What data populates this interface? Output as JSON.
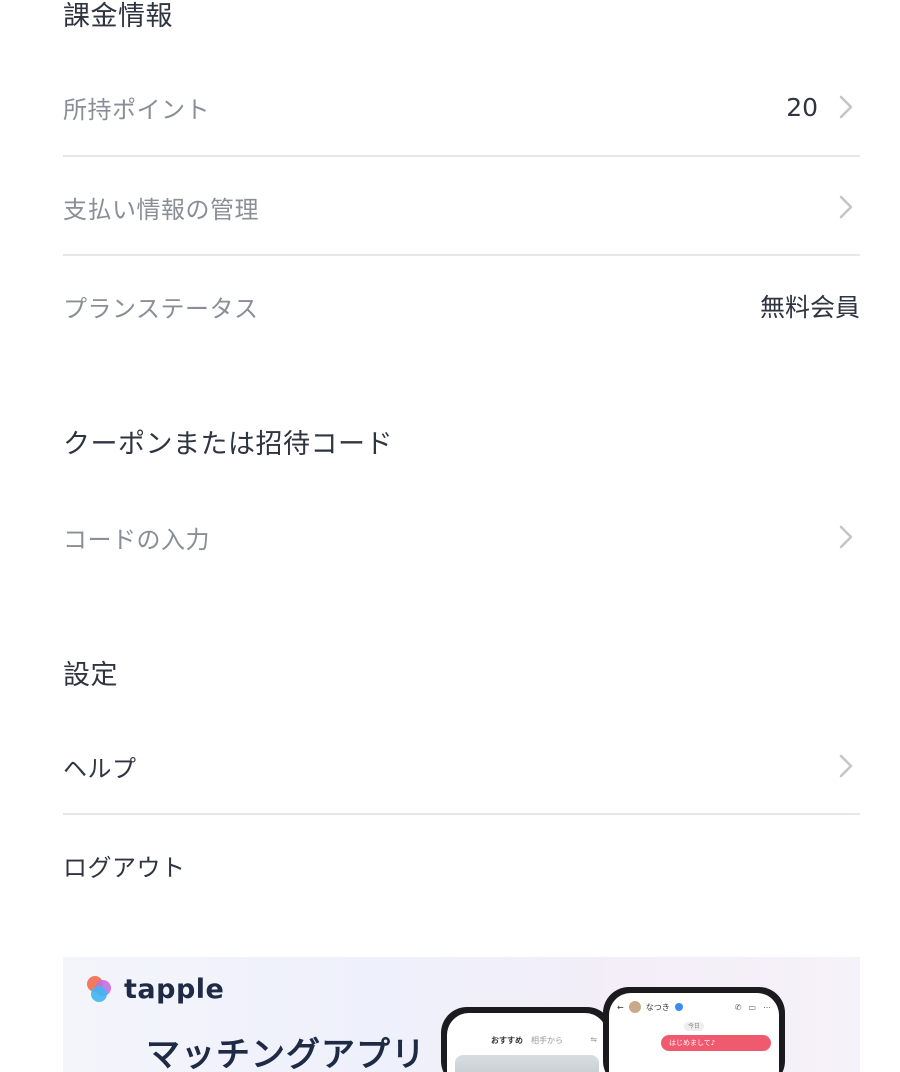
{
  "billing": {
    "title": "課金情報",
    "points_label": "所持ポイント",
    "points_value": "20",
    "payment_label": "支払い情報の管理",
    "plan_label": "プランステータス",
    "plan_value": "無料会員"
  },
  "coupon": {
    "title": "クーポンまたは招待コード",
    "code_label": "コードの入力"
  },
  "settings": {
    "title": "設定",
    "help_label": "ヘルプ",
    "logout_label": "ログアウト"
  },
  "banner": {
    "brand": "tapple",
    "headline": "マッチングアプリ",
    "phone1": {
      "tab_active": "おすすめ",
      "tab_inactive": "相手から"
    },
    "phone2": {
      "name": "なつき",
      "day": "今日",
      "message": "はじめまして♪"
    }
  },
  "colors": {
    "text_primary": "#2f3441",
    "text_secondary": "#8a8e96",
    "divider": "#e6e7ea",
    "chevron": "#c4c6cb",
    "bubble": "#ef5a6f"
  }
}
